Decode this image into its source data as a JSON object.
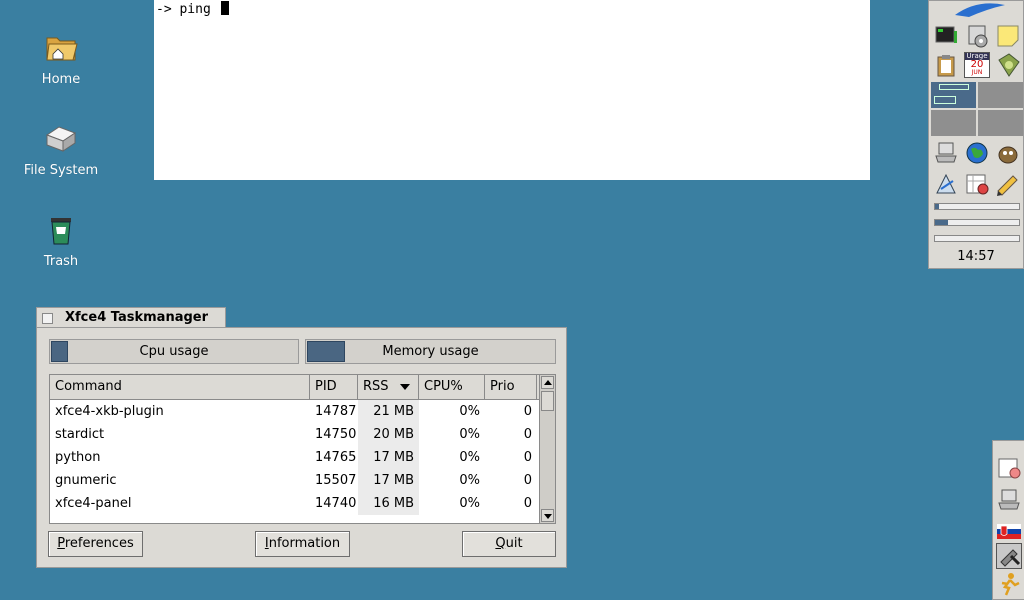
{
  "desktop": {
    "icons": [
      {
        "label": "Home",
        "icon": "home-folder-icon"
      },
      {
        "label": "File System",
        "icon": "drive-icon"
      },
      {
        "label": "Trash",
        "icon": "trash-icon"
      }
    ]
  },
  "terminal": {
    "prompt": "-> ping "
  },
  "panel": {
    "calendar_month_top": "Urage",
    "calendar_day": "20",
    "calendar_month": "JUN",
    "clock": "14:57",
    "progress_bars": [
      0.05,
      0.16,
      0.0
    ]
  },
  "taskmanager": {
    "title": "Xfce4 Taskmanager",
    "cpu_label": "Cpu usage",
    "memory_label": "Memory usage",
    "cpu_fill": 0.07,
    "memory_fill": 0.16,
    "columns": {
      "command": "Command",
      "pid": "PID",
      "rss": "RSS",
      "cpu": "CPU%",
      "prio": "Prio"
    },
    "rows": [
      {
        "command": "xfce4-xkb-plugin",
        "pid": "14787",
        "rss": "21 MB",
        "cpu": "0%",
        "prio": "0"
      },
      {
        "command": "stardict",
        "pid": "14750",
        "rss": "20 MB",
        "cpu": "0%",
        "prio": "0"
      },
      {
        "command": "python",
        "pid": "14765",
        "rss": "17 MB",
        "cpu": "0%",
        "prio": "0"
      },
      {
        "command": "gnumeric",
        "pid": "15507",
        "rss": "17 MB",
        "cpu": "0%",
        "prio": "0"
      },
      {
        "command": "xfce4-panel",
        "pid": "14740",
        "rss": "16 MB",
        "cpu": "0%",
        "prio": "0"
      }
    ],
    "buttons": {
      "preferences_first": "P",
      "preferences_rest": "references",
      "information_first": "I",
      "information_rest": "nformation",
      "quit_first": "Q",
      "quit_rest": "uit"
    }
  },
  "colors": {
    "desktop": "#3a7fa1",
    "panel": "#dcdad5",
    "accent": "#4a6682"
  }
}
